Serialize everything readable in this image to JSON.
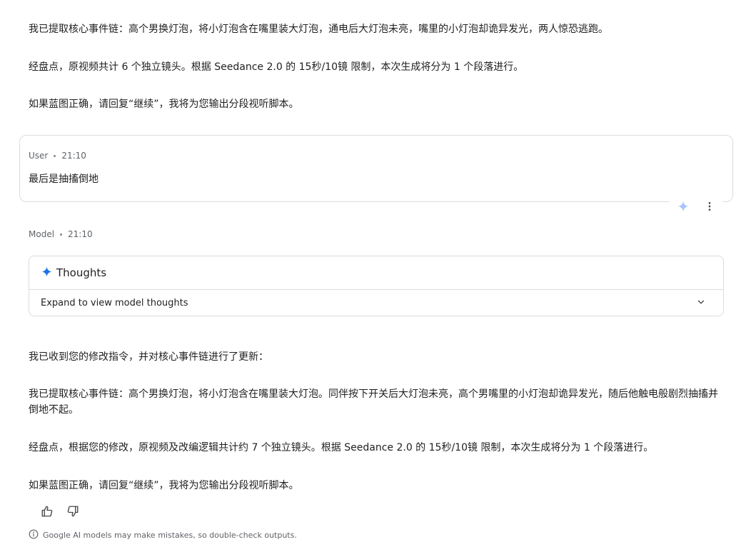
{
  "prev_model": {
    "paragraphs": [
      "我已提取核心事件链：高个男换灯泡，将小灯泡含在嘴里装大灯泡，通电后大灯泡未亮，嘴里的小灯泡却诡异发光，两人惊恐逃跑。",
      "经盘点，原视频共计 6 个独立镜头。根据 Seedance 2.0 的 15秒/10镜 限制，本次生成将分为 1 个段落进行。",
      "如果蓝图正确，请回复“继续”，我将为您输出分段视听脚本。"
    ]
  },
  "user_turn": {
    "role": "User",
    "time": "21:10",
    "text": "最后是抽搐倒地"
  },
  "model_turn": {
    "role": "Model",
    "time": "21:10",
    "thoughts_title": "Thoughts",
    "thoughts_expand": "Expand to view model thoughts",
    "paragraphs": [
      "我已收到您的修改指令，并对核心事件链进行了更新：",
      "我已提取核心事件链：高个男换灯泡，将小灯泡含在嘴里装大灯泡。同伴按下开关后大灯泡未亮，高个男嘴里的小灯泡却诡异发光，随后他触电般剧烈抽搐并倒地不起。",
      "经盘点，根据您的修改，原视频及改编逻辑共计约 7 个独立镜头。根据 Seedance 2.0 的 15秒/10镜 限制，本次生成将分为 1 个段落进行。",
      "如果蓝图正确，请回复“继续”，我将为您输出分段视听脚本。"
    ]
  },
  "disclaimer": "Google AI models may make mistakes, so double-check outputs.",
  "colors": {
    "accent": "#1a73e8",
    "border": "#dadce0",
    "muted": "#5f6368"
  }
}
